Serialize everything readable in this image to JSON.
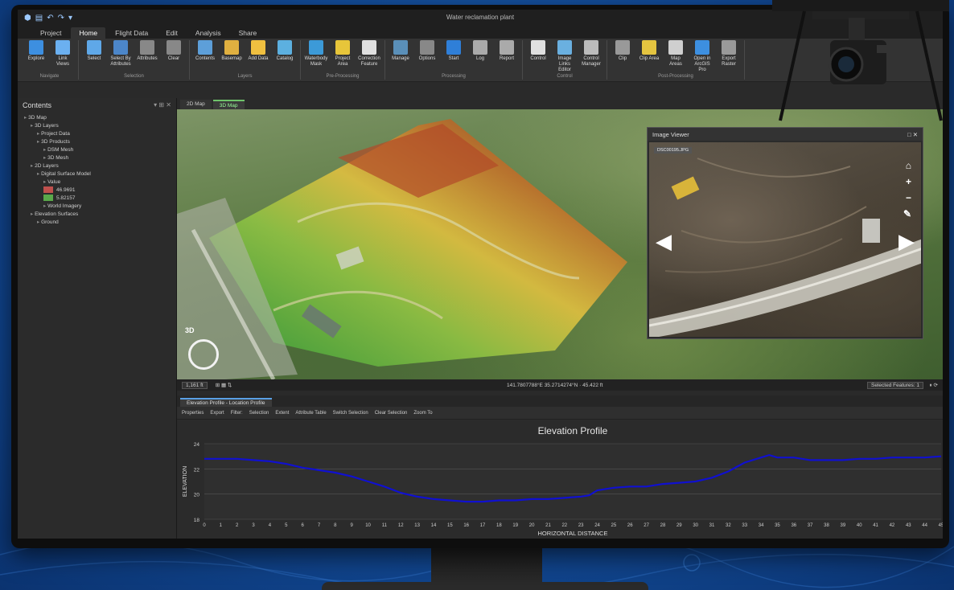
{
  "window": {
    "title": "Water reclamation plant"
  },
  "ribbon": {
    "tabs": [
      {
        "label": "Project",
        "active": false
      },
      {
        "label": "Home",
        "active": true
      },
      {
        "label": "Flight Data",
        "active": false
      },
      {
        "label": "Edit",
        "active": false
      },
      {
        "label": "Analysis",
        "active": false
      },
      {
        "label": "Share",
        "active": false
      }
    ],
    "groups": [
      {
        "label": "Navigate",
        "buttons": [
          "Explore",
          "Link Views"
        ],
        "colors": [
          "#3d8fe0",
          "#6bb0f0"
        ]
      },
      {
        "label": "Selection",
        "buttons": [
          "Select",
          "Select By Attributes",
          "Attributes",
          "Clear"
        ],
        "colors": [
          "#5fa8e8",
          "#4c86c9",
          "#888",
          "#888"
        ]
      },
      {
        "label": "Layers",
        "buttons": [
          "Contents",
          "Basemap",
          "Add Data",
          "Catalog"
        ],
        "colors": [
          "#5d9fd9",
          "#e0b040",
          "#f0c040",
          "#5cb0e0"
        ]
      },
      {
        "label": "Pre-Processing",
        "buttons": [
          "Waterbody Mask",
          "Project Area",
          "Correction Feature"
        ],
        "colors": [
          "#3c9ad8",
          "#e7c53a",
          "#e0e0e0"
        ]
      },
      {
        "label": "Processing",
        "buttons": [
          "Manage",
          "Options",
          "Start",
          "Log",
          "Report"
        ],
        "colors": [
          "#5a8fb8",
          "#888",
          "#2f7fd8",
          "#aaa",
          "#aaa"
        ]
      },
      {
        "label": "Control",
        "buttons": [
          "Control",
          "Image Links Editor",
          "Control Manager"
        ],
        "colors": [
          "#e0e0e0",
          "#6ab0e0",
          "#bbb"
        ]
      },
      {
        "label": "Post-Processing",
        "buttons": [
          "Clip",
          "Clip Area",
          "Map Areas",
          "Open in ArcGIS Pro",
          "Export Raster"
        ],
        "colors": [
          "#999",
          "#e4c440",
          "#cfcfcf",
          "#3d8fe0",
          "#999"
        ]
      }
    ]
  },
  "contents": {
    "title": "Contents",
    "tree": [
      {
        "label": "3D Map",
        "indent": 0
      },
      {
        "label": "3D Layers",
        "indent": 1
      },
      {
        "label": "Project Data",
        "indent": 2
      },
      {
        "label": "3D Products",
        "indent": 2
      },
      {
        "label": "DSM Mesh",
        "indent": 3
      },
      {
        "label": "3D Mesh",
        "indent": 3
      },
      {
        "label": "2D Layers",
        "indent": 1
      },
      {
        "label": "Digital Surface Model",
        "indent": 2
      },
      {
        "label": "Value",
        "indent": 3
      },
      {
        "label": "46.9691",
        "indent": 3,
        "swatch": "#c0504d"
      },
      {
        "label": "5.82157",
        "indent": 3,
        "swatch": "#5aa84a"
      },
      {
        "label": "World Imagery",
        "indent": 3
      },
      {
        "label": "Elevation Surfaces",
        "indent": 1
      },
      {
        "label": "Ground",
        "indent": 2
      }
    ]
  },
  "map_tabs": [
    {
      "label": "2D Map",
      "active": false
    },
    {
      "label": "3D Map",
      "active": true
    }
  ],
  "map": {
    "compass_label": "3D"
  },
  "viewer": {
    "title": "Image Viewer",
    "chip": "DSC00195.JPG"
  },
  "statusbar": {
    "scale": "1,161 ft",
    "coords": "141.7807788°E 35.2714274°N",
    "elevation": "45.422 ft",
    "selected": "Selected Features: 1"
  },
  "profile": {
    "tab_label": "Elevation Profile - Location Profile",
    "toolbar": [
      "Properties",
      "Export",
      "Filter:",
      "Selection",
      "Extent",
      "Attribute Table",
      "Switch Selection",
      "Clear Selection",
      "Zoom To"
    ]
  },
  "chart_data": {
    "type": "line",
    "title": "Elevation Profile",
    "xlabel": "HORIZONTAL DISTANCE",
    "ylabel": "ELEVATION",
    "xlim": [
      0,
      45
    ],
    "ylim": [
      18,
      24
    ],
    "yticks": [
      18,
      20,
      22,
      24
    ],
    "xticks": [
      0,
      1,
      2,
      3,
      4,
      5,
      6,
      7,
      8,
      9,
      10,
      11,
      12,
      13,
      14,
      15,
      16,
      17,
      18,
      19,
      20,
      21,
      22,
      23,
      24,
      25,
      26,
      27,
      28,
      29,
      30,
      31,
      32,
      33,
      34,
      35,
      36,
      37,
      38,
      39,
      40,
      41,
      42,
      43,
      44,
      45
    ],
    "grid": true,
    "series": [
      {
        "color": "#1010d0",
        "x": [
          0,
          1,
          2,
          3,
          4,
          5,
          6,
          7,
          8,
          9,
          10,
          11,
          12,
          13,
          14,
          15,
          16,
          17,
          18,
          19,
          20,
          21,
          22,
          23,
          23.5,
          24,
          25,
          26,
          27,
          28,
          29,
          30,
          31,
          32,
          33,
          34,
          34.5,
          35,
          36,
          37,
          38,
          39,
          40,
          41,
          42,
          43,
          44,
          45
        ],
        "y": [
          22.8,
          22.8,
          22.8,
          22.7,
          22.6,
          22.4,
          22.1,
          21.9,
          21.7,
          21.4,
          21.0,
          20.6,
          20.1,
          19.8,
          19.6,
          19.5,
          19.4,
          19.4,
          19.5,
          19.5,
          19.6,
          19.6,
          19.7,
          19.8,
          19.9,
          20.3,
          20.5,
          20.6,
          20.6,
          20.8,
          20.9,
          21.0,
          21.3,
          21.8,
          22.5,
          22.9,
          23.1,
          22.9,
          22.9,
          22.7,
          22.7,
          22.7,
          22.8,
          22.8,
          22.9,
          22.9,
          22.9,
          23.0
        ]
      }
    ]
  }
}
